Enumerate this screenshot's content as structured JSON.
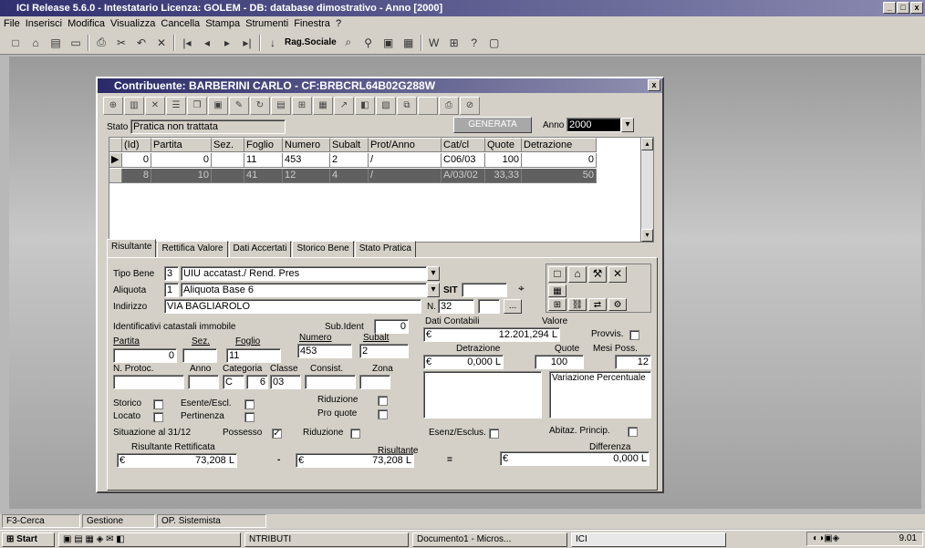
{
  "window": {
    "title": "ICI  Release 5.6.0 - Intestatario Licenza: GOLEM - DB: database dimostrativo - Anno [2000]"
  },
  "menu": [
    "File",
    "Inserisci",
    "Modifica",
    "Visualizza",
    "Cancella",
    "Stampa",
    "Strumenti",
    "Finestra",
    "?"
  ],
  "toolbar": {
    "search_label": "Rag.Sociale"
  },
  "dialog": {
    "title": "Contribuente: BARBERINI CARLO - CF:BRBCRL64B02G288W",
    "stato_label": "Stato",
    "stato_value": "Pratica non trattata",
    "generata_label": "GENERATA",
    "anno_label": "Anno",
    "anno_value": "2000"
  },
  "grid": {
    "headers": [
      "(Id)",
      "Partita",
      "Sez.",
      "Foglio",
      "Numero",
      "Subalt",
      "Prot/Anno",
      "Cat/cl",
      "Quote",
      "Detrazione"
    ],
    "rows": [
      [
        "0",
        "0",
        "",
        "11",
        "453",
        "2",
        "/",
        "C06/03",
        "100",
        "0"
      ],
      [
        "8",
        "10",
        "",
        "41",
        "12",
        "4",
        "/",
        "A/03/02",
        "33,33",
        "50"
      ]
    ]
  },
  "tabs": [
    "Risultante",
    "Rettifica Valore",
    "Dati Accertati",
    "Storico Bene",
    "Stato Pratica"
  ],
  "form": {
    "tipo_bene_label": "Tipo Bene",
    "tipo_bene_code": "3",
    "tipo_bene_value": "UIU accatast./ Rend. Pres",
    "aliquota_label": "Aliquota",
    "aliquota_code": "1",
    "aliquota_value": "Aliquota Base 6",
    "indirizzo_label": "Indirizzo",
    "indirizzo_value": "VIA BAGLIAROLO",
    "sit_label": "SIT",
    "n_label": "N.",
    "n_value": "32",
    "ellipsis": "...",
    "identificativi_label": "Identificativi catastali immobile",
    "sub_ident_label": "Sub.Ident",
    "sub_ident_value": "0",
    "partita_label": "Partita",
    "partita_value": "0",
    "sez_label": "Sez.",
    "foglio_label": "Foglio",
    "foglio_value": "11",
    "numero_label": "Numero",
    "numero_value": "453",
    "subalt_label": "Subalt",
    "subalt_value": "2",
    "nprotoc_label": "N. Protoc.",
    "anno_label": "Anno",
    "categoria_label": "Categoria",
    "categoria_a": "C",
    "categoria_b": "6",
    "classe_label": "Classe",
    "classe_value": "03",
    "consist_label": "Consist.",
    "zona_label": "Zona",
    "dati_contabili_label": "Dati Contabili",
    "valore_label": "Valore",
    "valore_value": "12.201,294",
    "provvis_label": "Provvis.",
    "detrazione_label": "Detrazione",
    "detrazione_value": "0,000",
    "quote_label": "Quote",
    "quote_value": "100",
    "mesi_poss_label": "Mesi Poss.",
    "mesi_poss_value": "12",
    "variazione_label": "Variazione Percentuale",
    "storico_label": "Storico",
    "esente_label": "Esente/Escl.",
    "riduzione_label": "Riduzione",
    "locato_label": "Locato",
    "pertinenza_label": "Pertinenza",
    "pro_quote_label": "Pro quote",
    "situazione_label": "Situazione al 31/12",
    "possesso_label": "Possesso",
    "riduzione2_label": "Riduzione",
    "esenz_label": "Esenz/Esclus.",
    "abitaz_label": "Abitaz. Princip.",
    "risultante_rettificata_label": "Risultante Rettificata",
    "risultante_rettificata_value": "73,208",
    "risultante_label": "Risultante",
    "risultante_value": "73,208",
    "differenza_label": "Differenza",
    "differenza_value": "0,000",
    "euro": "€",
    "lira": "L",
    "minus": "-",
    "equals": "="
  },
  "status": {
    "f3": "F3-Cerca",
    "gestione": "Gestione",
    "user": "OP. Sistemista"
  },
  "taskbar": {
    "start": "Start",
    "items": [
      "NTRIBUTI",
      "Documento1 - Micros...",
      "ICI"
    ],
    "clock": "9.01"
  }
}
